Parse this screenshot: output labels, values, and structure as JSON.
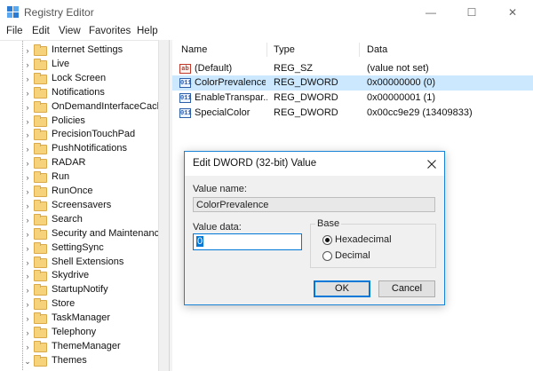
{
  "app": {
    "title": "Registry Editor"
  },
  "window_buttons": {
    "minimize": "—",
    "maximize": "☐",
    "close": "✕"
  },
  "menu": [
    "File",
    "Edit",
    "View",
    "Favorites",
    "Help"
  ],
  "tree": {
    "items": [
      "Internet Settings",
      "Live",
      "Lock Screen",
      "Notifications",
      "OnDemandInterfaceCach",
      "Policies",
      "PrecisionTouchPad",
      "PushNotifications",
      "RADAR",
      "Run",
      "RunOnce",
      "Screensavers",
      "Search",
      "Security and Maintenance",
      "SettingSync",
      "Shell Extensions",
      "Skydrive",
      "StartupNotify",
      "Store",
      "TaskManager",
      "Telephony",
      "ThemeManager",
      "Themes"
    ],
    "expanded_item": "Themes"
  },
  "list": {
    "columns": [
      "Name",
      "Type",
      "Data"
    ],
    "rows": [
      {
        "icon": "ab",
        "name": "(Default)",
        "type": "REG_SZ",
        "data": "(value not set)"
      },
      {
        "icon": "011",
        "name": "ColorPrevalence",
        "type": "REG_DWORD",
        "data": "0x00000000 (0)",
        "selected": true
      },
      {
        "icon": "011",
        "name": "EnableTranspar...",
        "type": "REG_DWORD",
        "data": "0x00000001 (1)"
      },
      {
        "icon": "011",
        "name": "SpecialColor",
        "type": "REG_DWORD",
        "data": "0x00cc9e29 (13409833)"
      }
    ]
  },
  "dialog": {
    "title": "Edit DWORD (32-bit) Value",
    "value_name_label": "Value name:",
    "value_name": "ColorPrevalence",
    "value_data_label": "Value data:",
    "value_data": "0",
    "base_label": "Base",
    "radio_hex": "Hexadecimal",
    "radio_dec": "Decimal",
    "selected_base": "Hexadecimal",
    "ok": "OK",
    "cancel": "Cancel"
  },
  "colors": {
    "selection": "#cce8ff",
    "accent": "#0078d7"
  }
}
